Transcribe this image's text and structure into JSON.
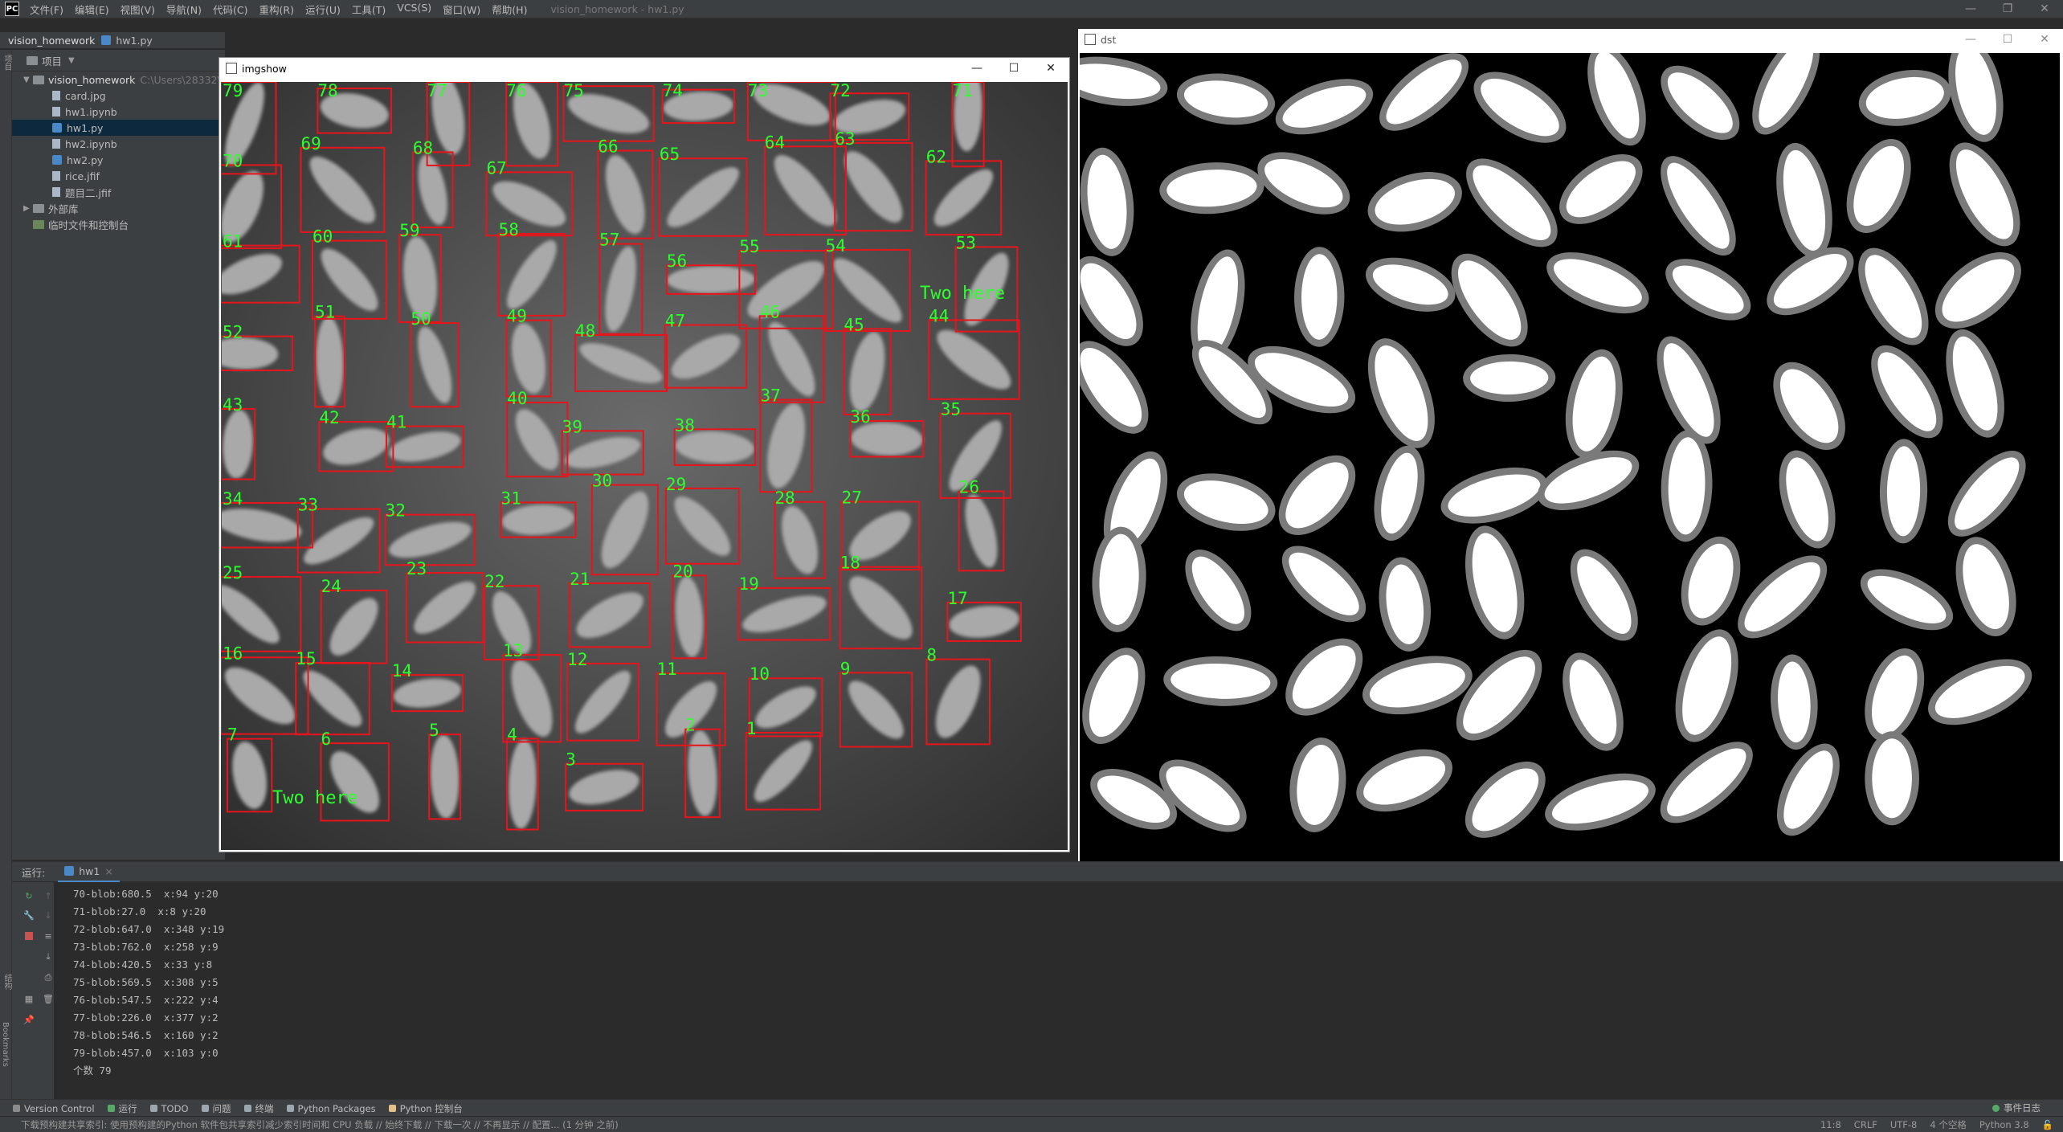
{
  "app": {
    "window_title": "vision_homework - hw1.py",
    "menu": [
      "文件(F)",
      "编辑(E)",
      "视图(V)",
      "导航(N)",
      "代码(C)",
      "重构(R)",
      "运行(U)",
      "工具(T)",
      "VCS(S)",
      "窗口(W)",
      "帮助(H)"
    ]
  },
  "navbar": {
    "project": "vision_homework",
    "file": "hw1.py"
  },
  "project_panel": {
    "header": "项目",
    "root": "vision_homework",
    "root_path": "C:\\Users\\28332\\",
    "files": [
      "card.jpg",
      "hw1.ipynb",
      "hw1.py",
      "hw2.ipynb",
      "hw2.py",
      "rice.jfif",
      "题目二.jfif"
    ],
    "selected_file": "hw1.py",
    "external": "外部库",
    "scratch": "临时文件和控制台"
  },
  "left_strip": {
    "top_label": "项目",
    "mid_label": "结构",
    "bottom_label": "Bookmarks"
  },
  "imgshow": {
    "title": "imgshow",
    "annotation_text": "Two here",
    "box_color": "#e8141c",
    "label_color": "#2dff2d",
    "blobs": [
      {
        "n": "79"
      },
      {
        "n": "78"
      },
      {
        "n": "77"
      },
      {
        "n": "76"
      },
      {
        "n": "75"
      },
      {
        "n": "74"
      },
      {
        "n": "73"
      },
      {
        "n": "72"
      },
      {
        "n": "71"
      },
      {
        "n": "70"
      },
      {
        "n": "69"
      },
      {
        "n": "68"
      },
      {
        "n": "67"
      },
      {
        "n": "66"
      },
      {
        "n": "65"
      },
      {
        "n": "64"
      },
      {
        "n": "63"
      },
      {
        "n": "62"
      },
      {
        "n": "61"
      },
      {
        "n": "60"
      },
      {
        "n": "59"
      },
      {
        "n": "58"
      },
      {
        "n": "57"
      },
      {
        "n": "56"
      },
      {
        "n": "55"
      },
      {
        "n": "54"
      },
      {
        "n": "53"
      },
      {
        "n": "52"
      },
      {
        "n": "51"
      },
      {
        "n": "50"
      },
      {
        "n": "49"
      },
      {
        "n": "48"
      },
      {
        "n": "47"
      },
      {
        "n": "46"
      },
      {
        "n": "45"
      },
      {
        "n": "44"
      },
      {
        "n": "43"
      },
      {
        "n": "42"
      },
      {
        "n": "41"
      },
      {
        "n": "40"
      },
      {
        "n": "39"
      },
      {
        "n": "38"
      },
      {
        "n": "37"
      },
      {
        "n": "36"
      },
      {
        "n": "35"
      },
      {
        "n": "34"
      },
      {
        "n": "33"
      },
      {
        "n": "32"
      },
      {
        "n": "31"
      },
      {
        "n": "30"
      },
      {
        "n": "29"
      },
      {
        "n": "28"
      },
      {
        "n": "27"
      },
      {
        "n": "26"
      },
      {
        "n": "25"
      },
      {
        "n": "24"
      },
      {
        "n": "23"
      },
      {
        "n": "22"
      },
      {
        "n": "21"
      },
      {
        "n": "20"
      },
      {
        "n": "19"
      },
      {
        "n": "18"
      },
      {
        "n": "17"
      },
      {
        "n": "16"
      },
      {
        "n": "15"
      },
      {
        "n": "14"
      },
      {
        "n": "13"
      },
      {
        "n": "12"
      },
      {
        "n": "11"
      },
      {
        "n": "10"
      },
      {
        "n": "9"
      },
      {
        "n": "8"
      },
      {
        "n": "7"
      },
      {
        "n": "6"
      },
      {
        "n": "5"
      },
      {
        "n": "4"
      },
      {
        "n": "3"
      },
      {
        "n": "2"
      },
      {
        "n": "1"
      }
    ]
  },
  "dst": {
    "title": "dst"
  },
  "run_panel": {
    "label": "运行:",
    "tab": "hw1",
    "lines": [
      "70-blob:680.5  x:94 y:20",
      "71-blob:27.0  x:8 y:20",
      "72-blob:647.0  x:348 y:19",
      "73-blob:762.0  x:258 y:9",
      "74-blob:420.5  x:33 y:8",
      "75-blob:569.5  x:308 y:5",
      "76-blob:547.5  x:222 y:4",
      "77-blob:226.0  x:377 y:2",
      "78-blob:546.5  x:160 y:2",
      "79-blob:457.0  x:103 y:0",
      "个数 79"
    ]
  },
  "bottom_toolbar": {
    "items": [
      "Version Control",
      "运行",
      "TODO",
      "问题",
      "终端",
      "Python Packages",
      "Python 控制台"
    ],
    "event_log": "事件日志"
  },
  "statusbar": {
    "message": "下载预构建共享索引: 使用预构建的Python 软件包共享索引减少索引时间和 CPU 负载 // 始终下载 // 下载一次 // 不再显示 // 配置... (1 分钟 之前)",
    "position": "11:8",
    "line_sep": "CRLF",
    "encoding": "UTF-8",
    "indent": "4 个空格",
    "interpreter": "Python 3.8"
  }
}
